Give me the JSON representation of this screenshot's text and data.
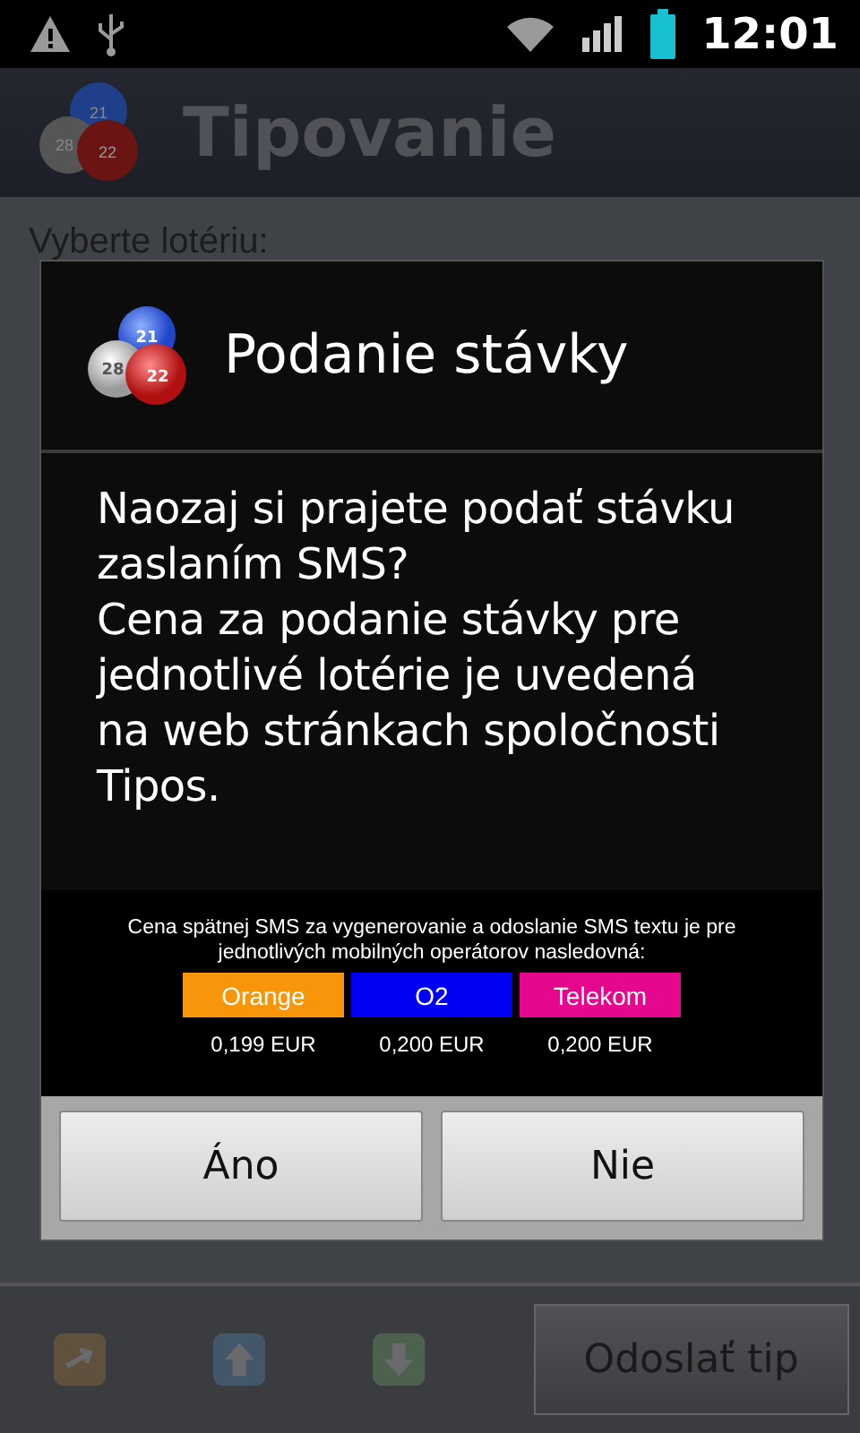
{
  "status_bar": {
    "time": "12:01"
  },
  "app": {
    "title": "Tipovanie",
    "logo_numbers": [
      "21",
      "28",
      "22"
    ]
  },
  "form": {
    "label": "Vyberte lotériu:"
  },
  "bottom_bar": {
    "send_button": "Odoslať tip"
  },
  "dialog": {
    "title": "Podanie stávky",
    "logo_numbers": [
      "21",
      "28",
      "22"
    ],
    "message": "Naozaj si prajete podať stávku zaslaním SMS?\nCena za podanie stávky pre jednotlivé lotérie je uvedená na web stránkach spoločnosti Tipos.",
    "note": "Cena spätnej SMS za vygenerovanie a odoslanie SMS textu je pre jednotlivých mobilných operátorov nasledovná:",
    "operators": [
      {
        "name": "Orange",
        "color": "#f7960a",
        "price": "0,199 EUR"
      },
      {
        "name": "O2",
        "color": "#0000f5",
        "price": "0,200 EUR"
      },
      {
        "name": "Telekom",
        "color": "#e5088d",
        "price": "0,200 EUR"
      }
    ],
    "buttons": [
      "Áno",
      "Nie"
    ]
  }
}
